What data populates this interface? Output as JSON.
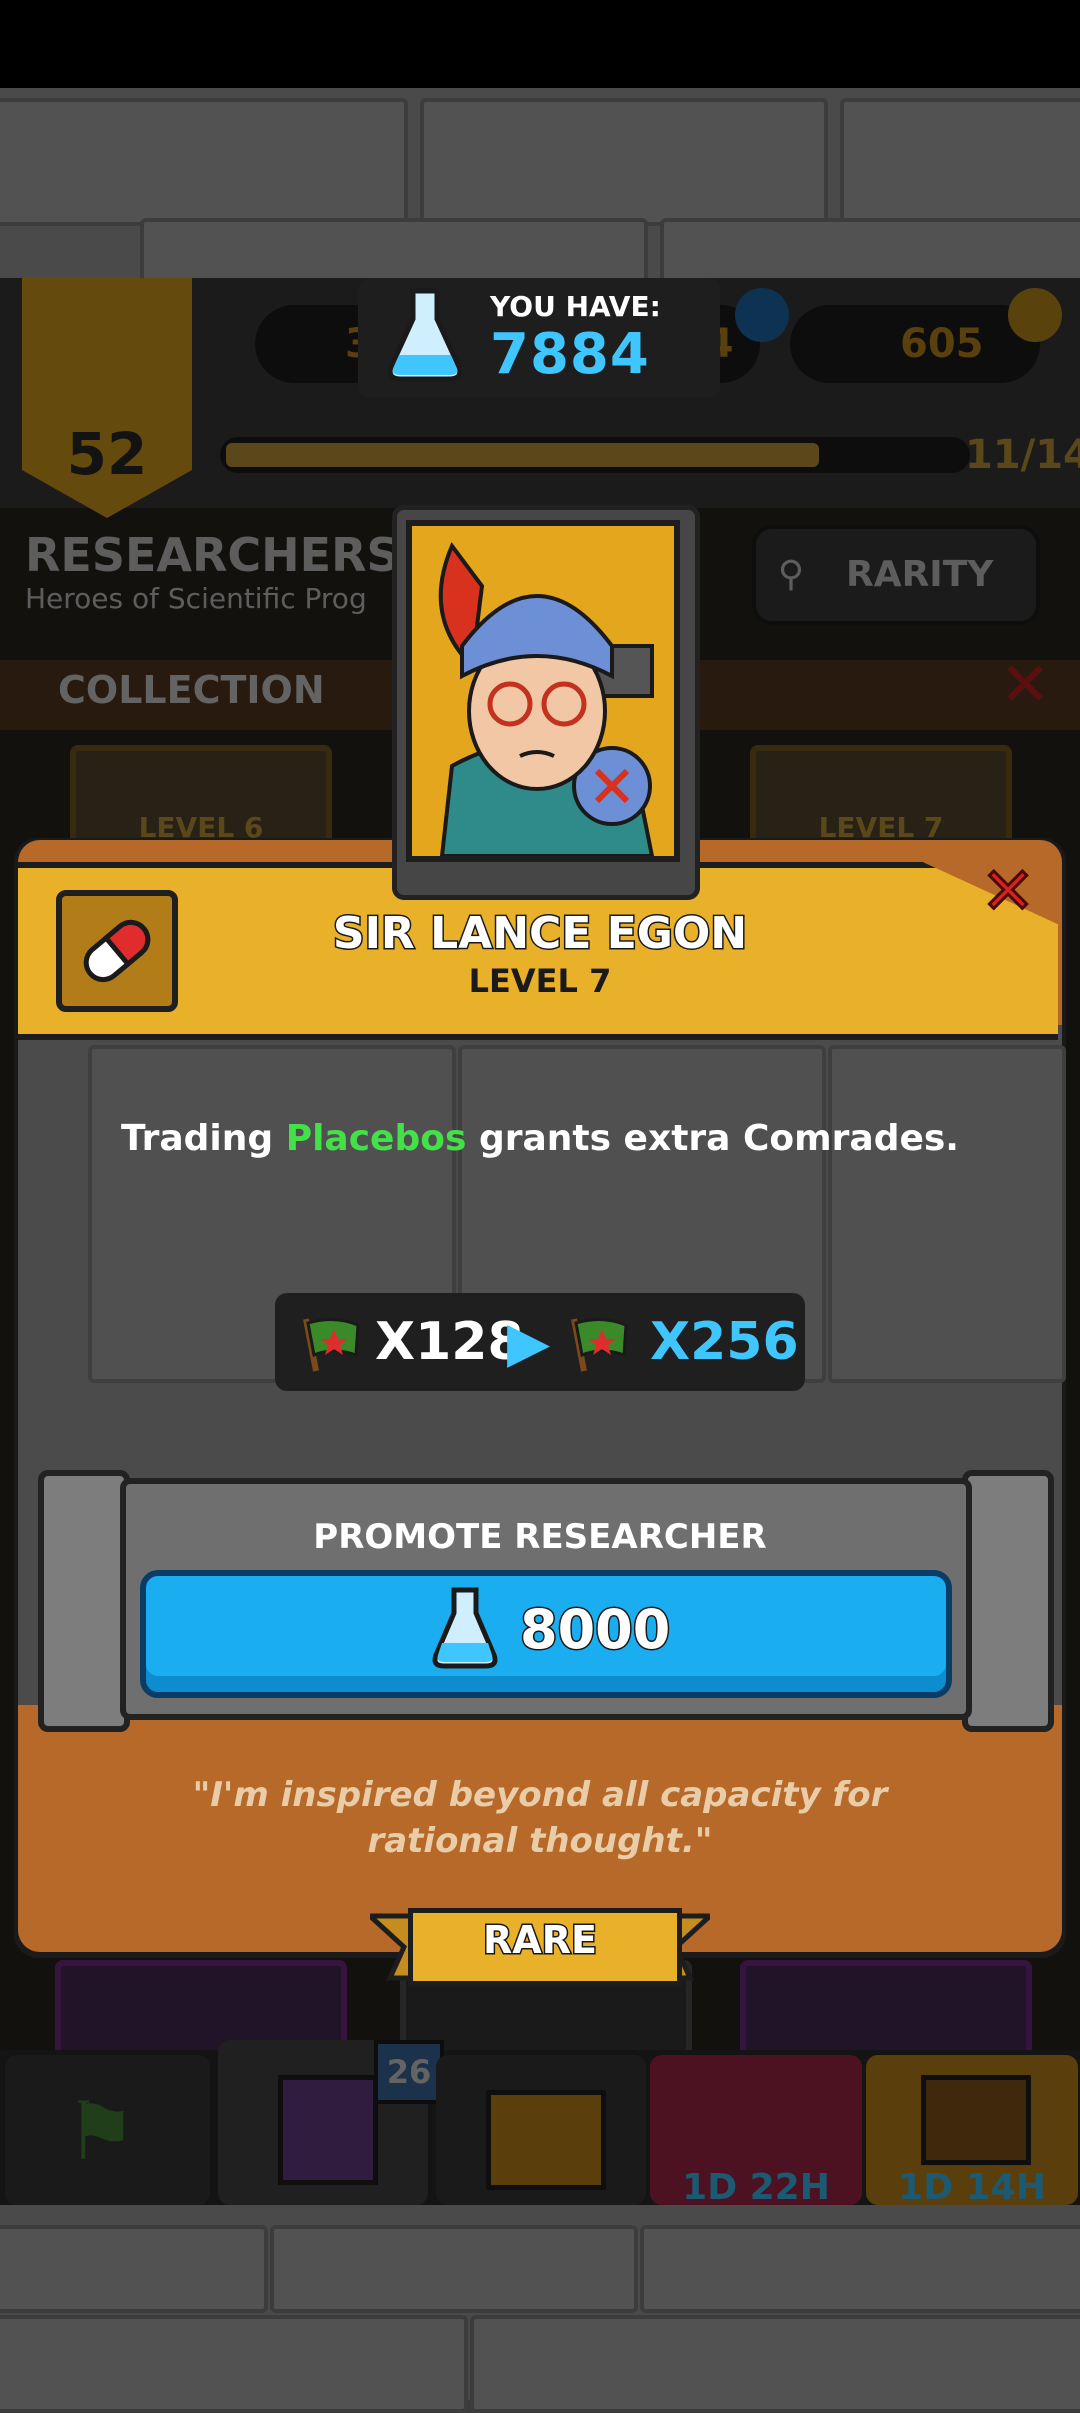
{
  "header": {
    "you_have_label": "YOU HAVE:",
    "you_have_value": "7884",
    "dimmed_currency_1": "32",
    "dimmed_currency_2": "884",
    "dimmed_gold": "605",
    "player_level": "52",
    "xp_progress_text": "11/14",
    "xp_progress_fraction": 0.79
  },
  "screen": {
    "title": "RESEARCHERS",
    "subtitle": "Heroes of Scientific Prog",
    "rarity_button": "RARITY",
    "collection_label": "COLLECTION",
    "bg_card_left_level": "LEVEL 6",
    "bg_card_right_level": "LEVEL 7"
  },
  "dialog": {
    "hero_name": "SIR LANCE EGON",
    "hero_level": "LEVEL 7",
    "description_before": "Trading ",
    "description_highlight": "Placebos",
    "description_after": " grants extra Comrades.",
    "reward_from": "X128",
    "reward_to": "X256",
    "promote_label": "PROMOTE RESEARCHER",
    "promote_cost": "8000",
    "quote": "\"I'm inspired beyond all capacity for rational thought.\"",
    "rarity": "RARE"
  },
  "nav": {
    "cards_badge": "26",
    "timer_1": "1D 22H",
    "timer_2": "1D 14H"
  },
  "colors": {
    "accent_blue": "#1aaef0",
    "gold": "#e9b12a",
    "highlight_green": "#44e04a",
    "wood": "#b7692a"
  }
}
